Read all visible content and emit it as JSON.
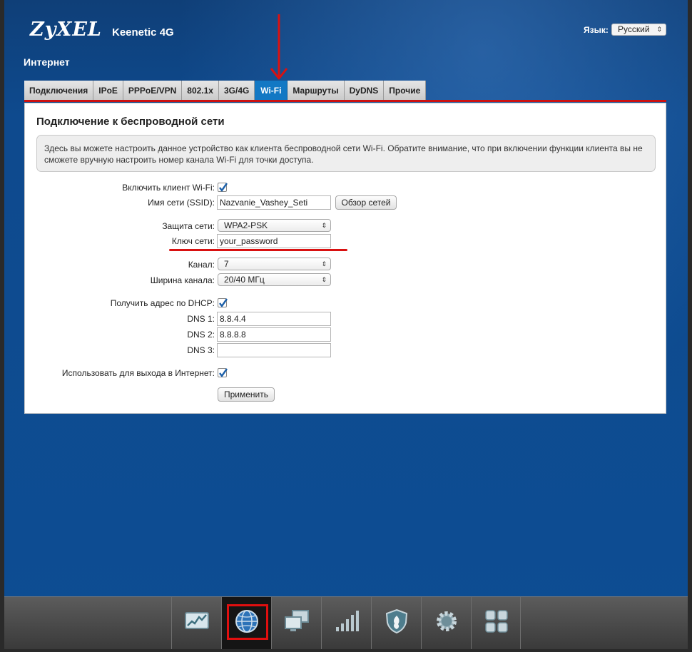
{
  "header": {
    "logo": "ZyXEL",
    "model": "Keenetic 4G",
    "language_label": "Язык:",
    "language_value": "Русский"
  },
  "section_title": "Интернет",
  "tabs": [
    {
      "label": "Подключения",
      "active": false
    },
    {
      "label": "IPoE",
      "active": false
    },
    {
      "label": "PPPoE/VPN",
      "active": false
    },
    {
      "label": "802.1x",
      "active": false
    },
    {
      "label": "3G/4G",
      "active": false
    },
    {
      "label": "Wi-Fi",
      "active": true
    },
    {
      "label": "Маршруты",
      "active": false
    },
    {
      "label": "DyDNS",
      "active": false
    },
    {
      "label": "Прочие",
      "active": false
    }
  ],
  "panel": {
    "title": "Подключение к беспроводной сети",
    "note": "Здесь вы можете настроить данное устройство как клиента беспроводной сети Wi-Fi. Обратите внимание, что при включении функции клиента вы не сможете вручную настроить номер канала Wi-Fi для точки доступа.",
    "enable_client_label": "Включить клиент Wi-Fi:",
    "enable_client_checked": true,
    "ssid_label": "Имя сети (SSID):",
    "ssid_value": "Nazvanie_Vashey_Seti",
    "browse_button": "Обзор сетей",
    "security_label": "Защита сети:",
    "security_value": "WPA2-PSK",
    "key_label": "Ключ сети:",
    "key_value": "your_password",
    "channel_label": "Канал:",
    "channel_value": "7",
    "width_label": "Ширина канала:",
    "width_value": "20/40 МГц",
    "dhcp_label": "Получить адрес по DHCP:",
    "dhcp_checked": true,
    "dns1_label": "DNS 1:",
    "dns1_value": "8.8.4.4",
    "dns2_label": "DNS 2:",
    "dns2_value": "8.8.8.8",
    "dns3_label": "DNS 3:",
    "dns3_value": "",
    "internet_label": "Использовать для выхода в Интернет:",
    "internet_checked": true,
    "apply_button": "Применить"
  },
  "dock": {
    "items": [
      "monitor-icon",
      "internet-globe-icon",
      "home-network-icon",
      "wifi-signal-icon",
      "security-shield-icon",
      "system-gear-icon",
      "apps-grid-icon"
    ],
    "active": "internet-globe-icon"
  },
  "colors": {
    "background": "#0d4d93",
    "active_tab": "#1278c4",
    "annotation_red": "#d91111"
  }
}
